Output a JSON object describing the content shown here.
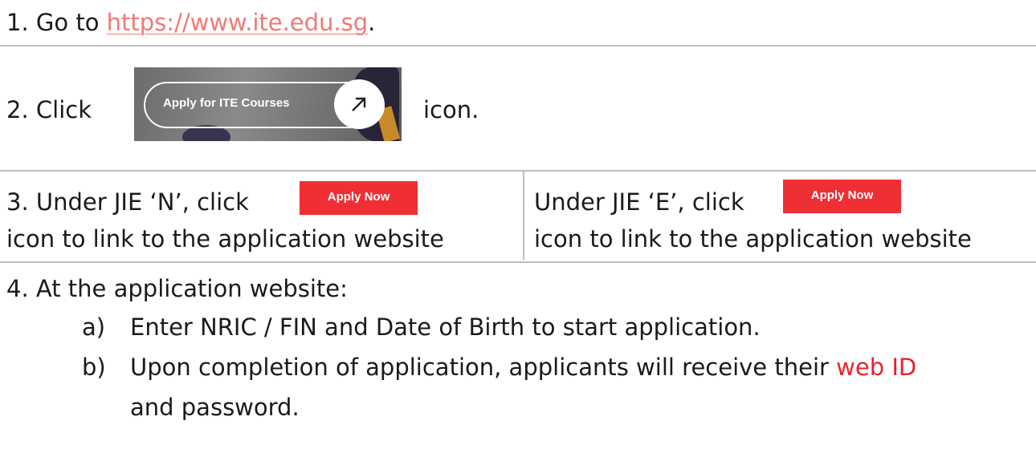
{
  "step1": {
    "prefix": "1.  Go to ",
    "link_text": "https://www.ite.edu.sg",
    "suffix": "."
  },
  "step2": {
    "lead": "2. Click",
    "banner_button_label": "Apply for ITE Courses",
    "banner_icon": "arrow-up-right-icon",
    "tail": "icon."
  },
  "step3": {
    "left_line1": "3. Under JIE ‘N’, click",
    "left_line2": "icon to link to the application website",
    "right_line1": "Under JIE ‘E’, click",
    "right_line2": "icon to link to the application website",
    "apply_button_label": "Apply Now"
  },
  "step4": {
    "heading": "4. At the application website:",
    "items": [
      {
        "marker": "a)",
        "text": "Enter NRIC / FIN and Date of Birth to start application."
      },
      {
        "marker": "b)",
        "text_before": "Upon completion of application, applicants will receive their ",
        "highlight": "web ID",
        "text_after": "and password."
      }
    ]
  },
  "colors": {
    "link": "#f07a74",
    "apply_button": "#f02f35",
    "highlight": "#e8232b",
    "rule": "#bdbdbd"
  }
}
